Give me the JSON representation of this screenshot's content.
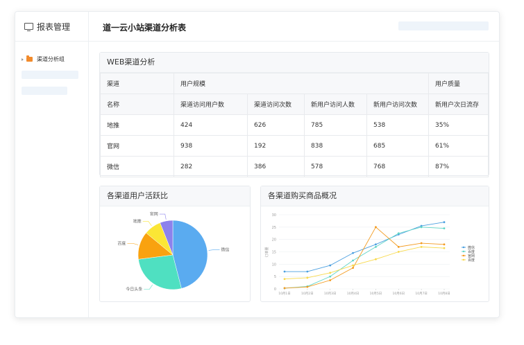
{
  "sidebar": {
    "title": "报表管理",
    "group_label": "渠道分析组"
  },
  "header": {
    "title": "道一云小站渠道分析表"
  },
  "web_table": {
    "title": "WEB渠道分析",
    "group_headers": [
      "渠道",
      "用户规模",
      "用户质量"
    ],
    "columns": [
      "名称",
      "渠道访问用户数",
      "渠道访问次数",
      "新用户访问人数",
      "新用户访问次数",
      "新用户次日流存"
    ],
    "rows": [
      [
        "地推",
        "424",
        "626",
        "785",
        "538",
        "35%"
      ],
      [
        "官网",
        "938",
        "192",
        "838",
        "685",
        "61%"
      ],
      [
        "微信",
        "282",
        "386",
        "578",
        "768",
        "87%"
      ]
    ]
  },
  "pie_card": {
    "title": "各渠道用户活跃比"
  },
  "line_card": {
    "title": "各渠道购买商品概况"
  },
  "chart_data": [
    {
      "type": "pie",
      "title": "各渠道用户活跃比",
      "slices": [
        {
          "label": "微信",
          "value": 46,
          "color": "#5aabf0"
        },
        {
          "label": "今日头条",
          "value": 27,
          "color": "#4fe0c1"
        },
        {
          "label": "百度",
          "value": 13,
          "color": "#f9a20f"
        },
        {
          "label": "地推",
          "value": 8,
          "color": "#fbe635"
        },
        {
          "label": "官网",
          "value": 6,
          "color": "#8c82ec"
        }
      ]
    },
    {
      "type": "line",
      "title": "各渠道购买商品概况",
      "ylabel": "订单量",
      "ylim": [
        0,
        30
      ],
      "yticks": [
        0,
        5,
        10,
        15,
        20,
        25,
        30
      ],
      "categories": [
        "10月1日",
        "10月2日",
        "10月3日",
        "10月4日",
        "10月5日",
        "10月6日",
        "10月7日",
        "10月8日"
      ],
      "series": [
        {
          "name": "微信",
          "color": "#4a9fe0",
          "values": [
            7,
            7,
            9.5,
            14.5,
            18,
            22,
            25.5,
            27
          ]
        },
        {
          "name": "百度",
          "color": "#5fd5c6",
          "values": [
            0.3,
            1,
            5,
            11.5,
            17,
            22.5,
            25,
            24.5
          ]
        },
        {
          "name": "官网",
          "color": "#f39a1e",
          "values": [
            0.3,
            0.8,
            3.5,
            8.5,
            25,
            17,
            18.5,
            18
          ]
        },
        {
          "name": "百度",
          "color": "#f8d94a",
          "values": [
            4,
            4.5,
            6.5,
            9.5,
            12,
            15,
            17,
            16.5
          ]
        }
      ]
    }
  ]
}
